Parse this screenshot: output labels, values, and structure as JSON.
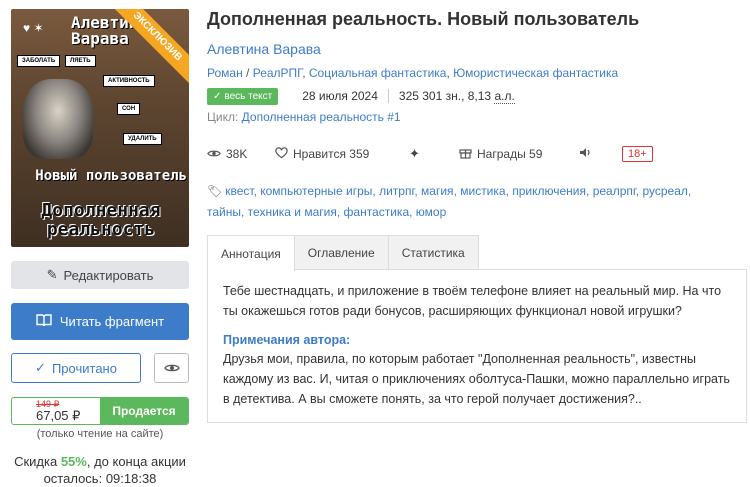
{
  "cover": {
    "author_text": "Алевтина Варава",
    "exclusive": "ЭКСКЛЮЗИВ",
    "chips": [
      "ЗАБОЛАТЬ",
      "ЛЯЕТЬ",
      "АКТИВНОСТЬ",
      "СОН",
      "УДАЛИТЬ"
    ],
    "title_line1": "Новый пользователь",
    "title_line2": "Дополненная реальность"
  },
  "actions": {
    "edit": "Редактировать",
    "read_fragment": "Читать фрагмент",
    "read_done": "Прочитано"
  },
  "price": {
    "old": "149 ₽",
    "new": "67,05 ₽",
    "sale_label": "Продается",
    "note": "(только чтение на сайте)",
    "discount_prefix": "Скидка ",
    "discount_pct": "55%",
    "discount_suffix": ", до конца акции",
    "remaining_label": "осталось: ",
    "remaining_time": "09:18:38"
  },
  "book": {
    "title": "Дополненная реальность. Новый пользователь",
    "author": "Алевтина Варава",
    "genres": [
      "Роман",
      "РеалРПГ",
      "Социальная фантастика",
      "Юмористическая фантастика"
    ],
    "status": "весь текст",
    "date": "28 июля 2024",
    "size": "325 301 зн., 8,13 ",
    "size_unit": "а.л.",
    "cycle_label": "Цикл: ",
    "cycle_name": "Дополненная реальность #1"
  },
  "stats": {
    "views": "38K",
    "likes_label": "Нравится 359",
    "awards_label": "Награды 59",
    "age": "18+"
  },
  "tags": [
    "квест",
    "компьютерные игры",
    "литрпг",
    "магия",
    "мистика",
    "приключения",
    "реалрпг",
    "русреал",
    "тайны",
    "техника и магия",
    "фантастика",
    "юмор"
  ],
  "tabs": [
    "Аннотация",
    "Оглавление",
    "Статистика"
  ],
  "annotation": {
    "text": "Тебе шестнадцать, и приложение в твоём телефоне влияет на реальный мир. На что ты окажешься готов ради бонусов, расширяющих функционал новой игрушки?",
    "notes_heading": "Примечания автора:",
    "notes_text": "Друзья мои, правила, по которым работает \"Дополненная реальность\", известны каждому из вас. И, читая о приключениях оболтуса-Пашки, можно параллельно играть в детектива. А вы сможете понять, за что герой получает достижения?.."
  },
  "colors": {
    "accent": "#3d7cc9",
    "success": "#5cb85c",
    "danger": "#d33333"
  }
}
